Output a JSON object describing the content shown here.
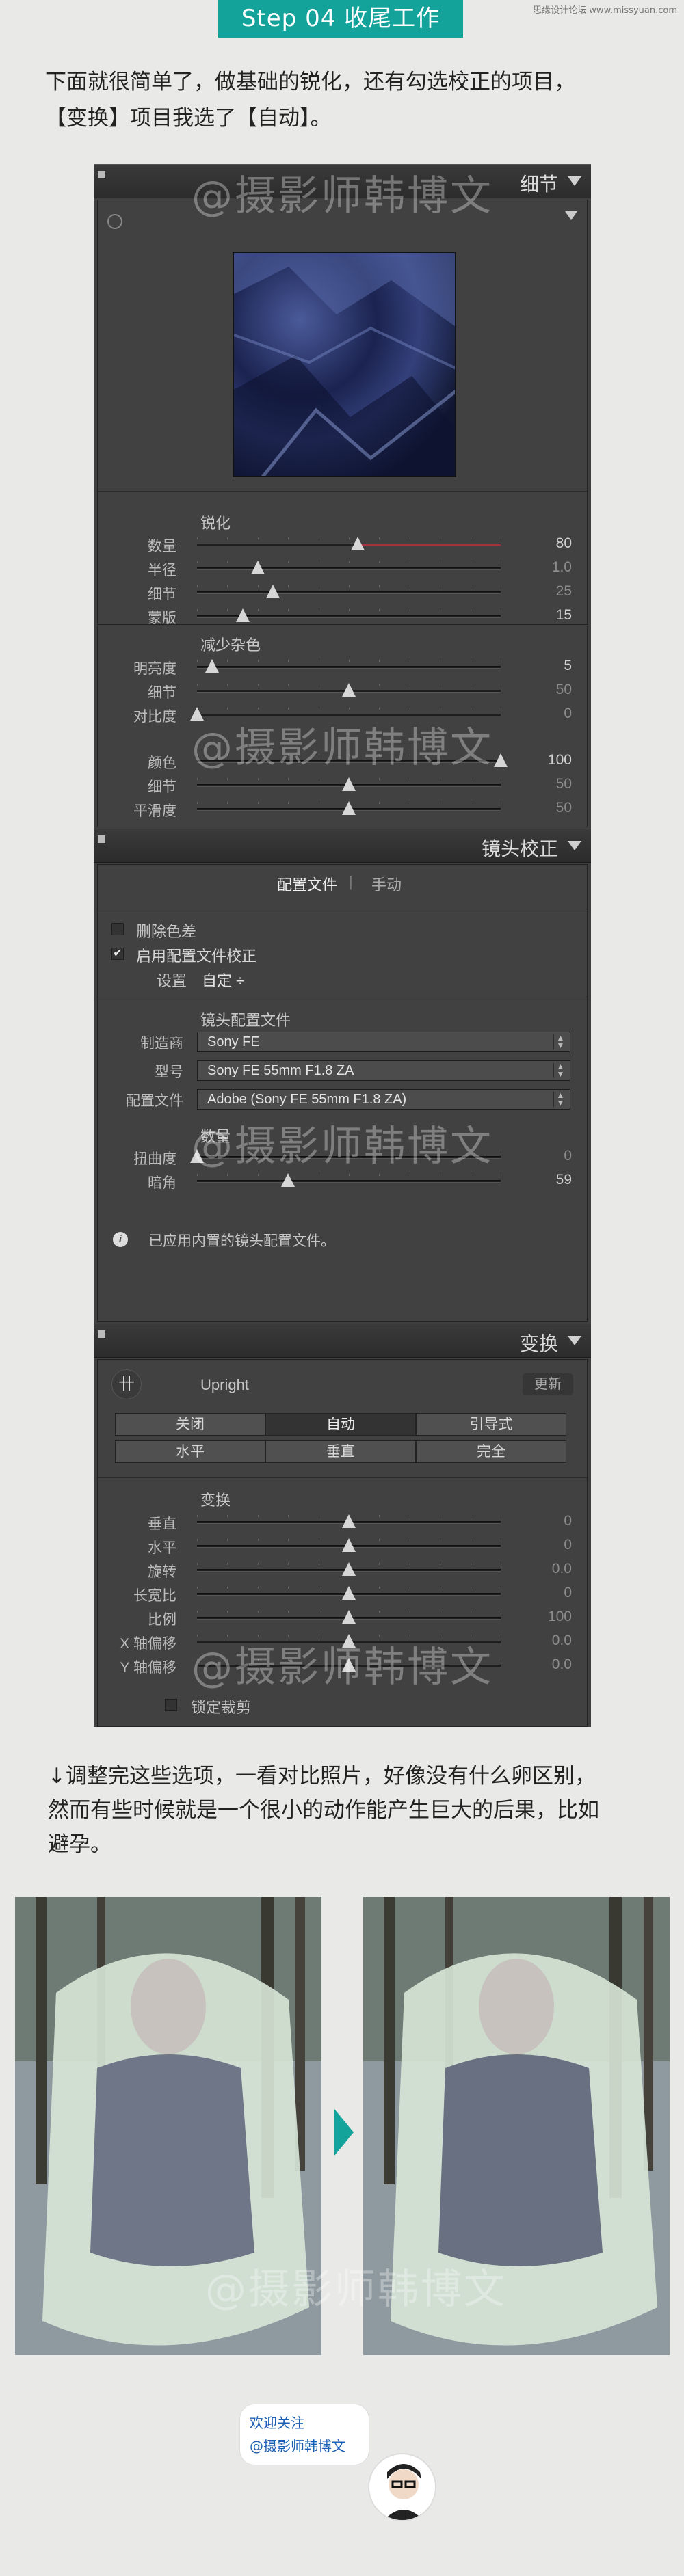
{
  "site_credit": "思缘设计论坛 www.missyuan.com",
  "step_title": "Step 04 收尾工作",
  "intro": [
    "下面就很简单了，做基础的锐化，还有勾选校正的项目，",
    "【变换】项目我选了【自动】。"
  ],
  "watermark": "@摄影师韩博文",
  "detail": {
    "title": "细节",
    "sharpen": {
      "heading": "锐化",
      "rows": [
        {
          "label": "数量",
          "value": "80",
          "level": 0.53,
          "dim": false
        },
        {
          "label": "半径",
          "value": "1.0",
          "level": 0.2,
          "dim": true
        },
        {
          "label": "细节",
          "value": "25",
          "level": 0.25,
          "dim": true
        },
        {
          "label": "蒙版",
          "value": "15",
          "level": 0.15,
          "dim": false
        }
      ]
    },
    "noise": {
      "heading": "减少杂色",
      "rows": [
        {
          "label": "明亮度",
          "value": "5",
          "level": 0.05,
          "dim": false
        },
        {
          "label": "细节",
          "value": "50",
          "level": 0.5,
          "dim": true
        },
        {
          "label": "对比度",
          "value": "0",
          "level": 0.0,
          "dim": true
        }
      ]
    },
    "color_rows": [
      {
        "label": "颜色",
        "value": "100",
        "level": 1.0,
        "dim": false
      },
      {
        "label": "细节",
        "value": "50",
        "level": 0.5,
        "dim": true
      },
      {
        "label": "平滑度",
        "value": "50",
        "level": 0.5,
        "dim": true
      }
    ]
  },
  "lens": {
    "title": "镜头校正",
    "tab_profile": "配置文件",
    "tab_manual": "手动",
    "tab_sep": "|",
    "remove_ca": "删除色差",
    "enable_profile": "启用配置文件校正",
    "setup_label": "设置",
    "setup_value": "自定 ÷",
    "profile_heading": "镜头配置文件",
    "make_label": "制造商",
    "make_value": "Sony FE",
    "model_label": "型号",
    "model_value": "Sony FE 55mm F1.8 ZA",
    "profile_label": "配置文件",
    "profile_value": "Adobe (Sony FE 55mm F1.8 ZA)",
    "amount_heading": "数量",
    "rows": [
      {
        "label": "扭曲度",
        "value": "0",
        "level": 0.0,
        "dim": true
      },
      {
        "label": "暗角",
        "value": "59",
        "level": 0.3,
        "dim": false
      }
    ],
    "info_text": "已应用内置的镜头配置文件。"
  },
  "transform": {
    "title": "变换",
    "upright_label": "Upright",
    "update_btn": "更新",
    "buttons": [
      "关闭",
      "自动",
      "引导式",
      "水平",
      "垂直",
      "完全"
    ],
    "active_button": "自动",
    "heading": "变换",
    "rows": [
      {
        "label": "垂直",
        "value": "0",
        "level": 0.5,
        "dim": true
      },
      {
        "label": "水平",
        "value": "0",
        "level": 0.5,
        "dim": true
      },
      {
        "label": "旋转",
        "value": "0.0",
        "level": 0.5,
        "dim": true
      },
      {
        "label": "长宽比",
        "value": "0",
        "level": 0.5,
        "dim": true
      },
      {
        "label": "比例",
        "value": "100",
        "level": 0.5,
        "dim": true
      },
      {
        "label": "X 轴偏移",
        "value": "0.0",
        "level": 0.5,
        "dim": true
      },
      {
        "label": "Y 轴偏移",
        "value": "0.0",
        "level": 0.5,
        "dim": true
      }
    ],
    "constrain": "锁定裁剪"
  },
  "outro": [
    "↓调整完这些选项，一看对比照片，好像没有什么卵区别，",
    "然而有些时候就是一个很小的动作能产生巨大的后果，比如",
    "避孕。"
  ],
  "follow": [
    "欢迎关注",
    "@摄影师韩博文"
  ],
  "colors": {
    "accent": "#14a39a",
    "panel": "#3f3f3f",
    "header": "#2f2f2f",
    "amount_line": "#a3323a"
  }
}
